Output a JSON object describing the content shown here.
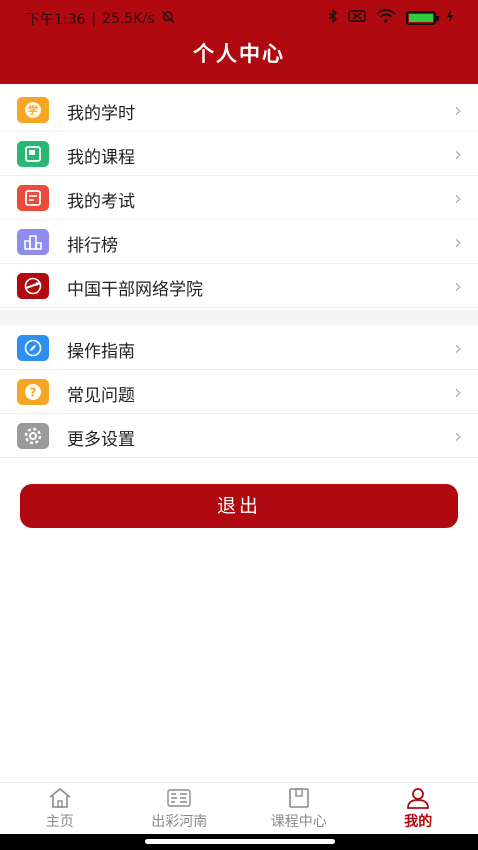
{
  "status": {
    "time": "下午1:36",
    "speed": "25.5K/s",
    "battery_level": 1.0,
    "colors": {
      "battery": "#2ecc40"
    }
  },
  "header": {
    "title": "个人中心",
    "color": "#b0090f"
  },
  "menu_group_1": [
    {
      "label": "我的学时",
      "icon": "study-hours-icon",
      "color": "#f5a623"
    },
    {
      "label": "我的课程",
      "icon": "course-icon",
      "color": "#2bb673"
    },
    {
      "label": "我的考试",
      "icon": "exam-icon",
      "color": "#e84c3d"
    },
    {
      "label": "排行榜",
      "icon": "ranking-icon",
      "color": "#8e8cf0"
    },
    {
      "label": "中国干部网络学院",
      "icon": "cadre-academy-icon",
      "color": "#b0090f"
    }
  ],
  "menu_group_2": [
    {
      "label": "操作指南",
      "icon": "compass-icon",
      "color": "#2f8ff0"
    },
    {
      "label": "常见问题",
      "icon": "question-icon",
      "color": "#f5a623"
    },
    {
      "label": "更多设置",
      "icon": "settings-icon",
      "color": "#9a9a9a"
    }
  ],
  "logout_label": "退出",
  "tabbar": [
    {
      "label": "主页",
      "icon": "home-icon",
      "active": false
    },
    {
      "label": "出彩河南",
      "icon": "henan-icon",
      "active": false
    },
    {
      "label": "课程中心",
      "icon": "course-center-icon",
      "active": false
    },
    {
      "label": "我的",
      "icon": "profile-icon",
      "active": true
    }
  ]
}
